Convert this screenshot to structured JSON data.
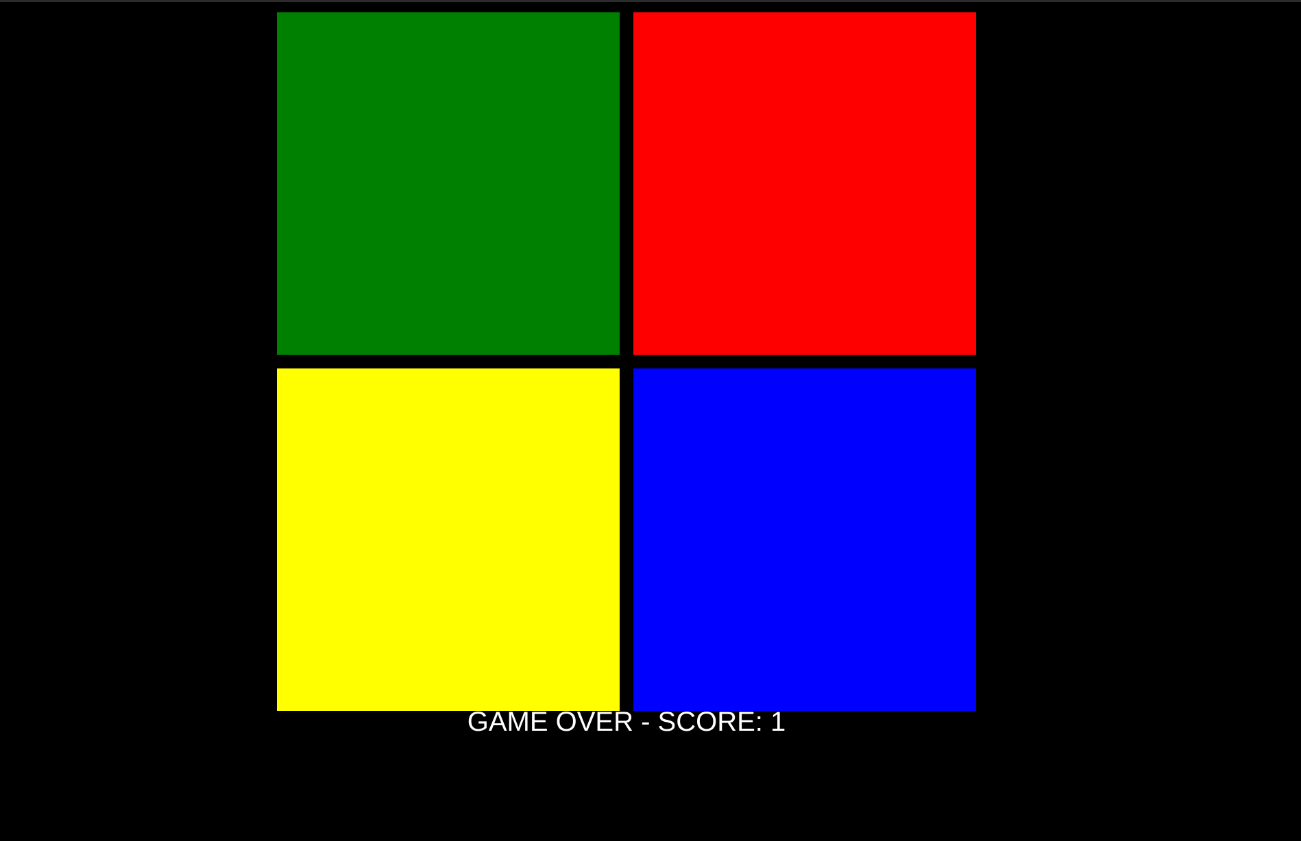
{
  "game": {
    "pads": [
      {
        "color_name": "green",
        "color": "#008000"
      },
      {
        "color_name": "red",
        "color": "#ff0000"
      },
      {
        "color_name": "yellow",
        "color": "#ffff00"
      },
      {
        "color_name": "blue",
        "color": "#0000ff"
      }
    ],
    "status_text": "GAME OVER - SCORE: 1",
    "score": 1,
    "background": "#000000"
  }
}
